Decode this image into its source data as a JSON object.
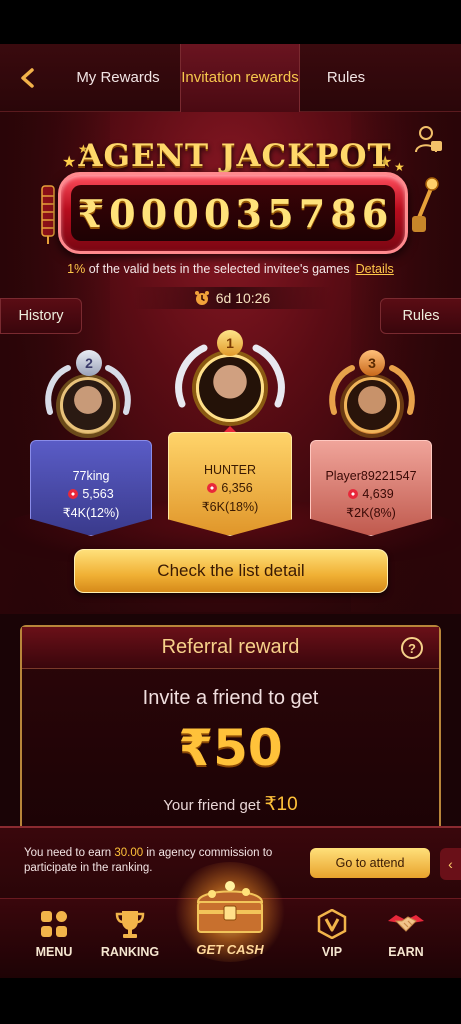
{
  "nav": {
    "back_icon": "chevron-left-icon",
    "tabs": [
      {
        "label": "My Rewards"
      },
      {
        "label": "Invitation rewards"
      },
      {
        "label": "Rules"
      }
    ]
  },
  "jackpot": {
    "title": "AGENT JACKPOT",
    "currency": "₹",
    "digits": [
      "0",
      "0",
      "0",
      "0",
      "3",
      "5",
      "7",
      "8",
      "6"
    ],
    "note_pct": "1%",
    "note_text": " of the valid bets in the selected invitee's games",
    "details_label": "Details",
    "timer": "6d 10:26",
    "history_label": "History",
    "rules_label": "Rules"
  },
  "leaders": [
    {
      "rank": "2",
      "name": "77king",
      "score": "5,563",
      "reward": "₹4K(12%)"
    },
    {
      "rank": "1",
      "name": "HUNTER",
      "score": "6,356",
      "reward": "₹6K(18%)"
    },
    {
      "rank": "3",
      "name": "Player89221547",
      "score": "4,639",
      "reward": "₹2K(8%)"
    }
  ],
  "check_button": "Check the list detail",
  "referral": {
    "title": "Referral reward",
    "help_label": "?",
    "invite_text": "Invite a friend to get",
    "amount": "₹50",
    "friend_text": "Your friend get ",
    "friend_amount": "₹10"
  },
  "banner": {
    "text_pre": "You need to earn ",
    "text_value": "30.00",
    "text_post": " in agency commission to participate in the ranking.",
    "button": "Go to attend",
    "arrow": "‹"
  },
  "bottom_nav": [
    {
      "label": "MENU",
      "icon": "menu-grid-icon"
    },
    {
      "label": "RANKING",
      "icon": "trophy-icon"
    },
    {
      "label": "GET CASH",
      "icon": "treasure-chest-icon"
    },
    {
      "label": "VIP",
      "icon": "vip-badge-icon"
    },
    {
      "label": "EARN",
      "icon": "handshake-icon"
    }
  ],
  "colors": {
    "accent_gold": "#f6c74d",
    "background": "#1a0406",
    "jackpot_red": "#b80d1e"
  }
}
